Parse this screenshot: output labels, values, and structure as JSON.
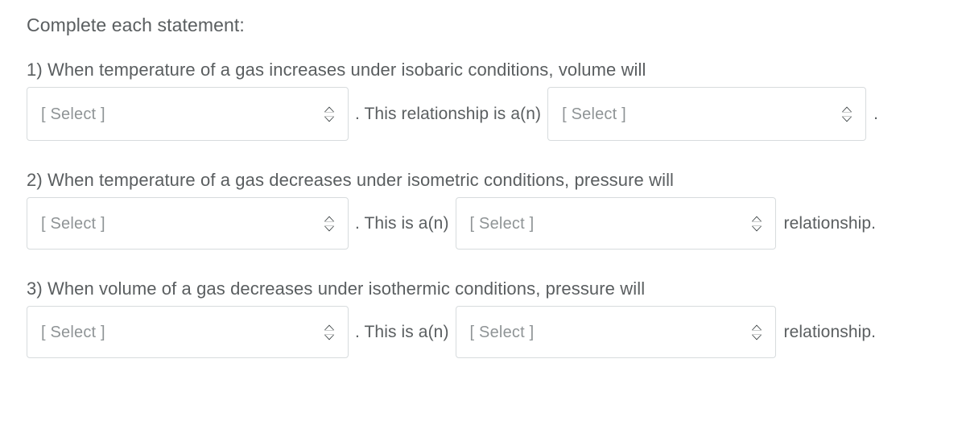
{
  "heading": "Complete each statement:",
  "icons": {
    "dropdown": "chevron-up-down-icon"
  },
  "colors": {
    "text": "#5a5e60",
    "placeholder": "#8f9496",
    "border": "#d7dbdd",
    "background": "#ffffff",
    "chevron": "#2d3436"
  },
  "statements": [
    {
      "number": "1)",
      "prompt": "1) When temperature of a gas increases under isobaric conditions, volume will",
      "select_1": {
        "value": "[ Select ]",
        "placeholder": "[ Select ]"
      },
      "mid_text": ". This relationship is a(n)",
      "select_2": {
        "value": "[ Select ]",
        "placeholder": "[ Select ]"
      },
      "tail_text": "."
    },
    {
      "number": "2)",
      "prompt": "2) When temperature of a gas decreases under isometric conditions, pressure will",
      "select_1": {
        "value": "[ Select ]",
        "placeholder": "[ Select ]"
      },
      "mid_text": ". This is a(n)",
      "select_2": {
        "value": "[ Select ]",
        "placeholder": "[ Select ]"
      },
      "tail_text": "relationship."
    },
    {
      "number": "3)",
      "prompt": "3) When volume of a gas decreases under isothermic conditions, pressure will",
      "select_1": {
        "value": "[ Select ]",
        "placeholder": "[ Select ]"
      },
      "mid_text": ". This is a(n)",
      "select_2": {
        "value": "[ Select ]",
        "placeholder": "[ Select ]"
      },
      "tail_text": "relationship."
    }
  ]
}
